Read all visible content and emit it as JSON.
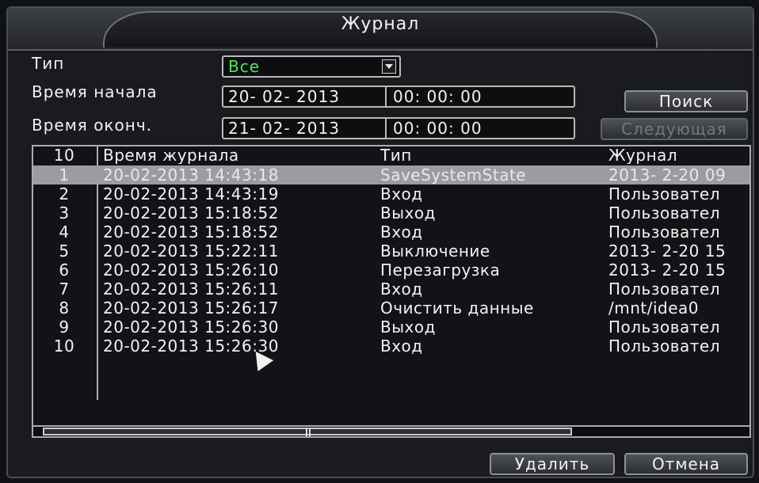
{
  "window": {
    "title": "Журнал"
  },
  "filters": {
    "type_label": "Тип",
    "type_value": "Все",
    "start_label": "Время начала",
    "start_date": "20- 02- 2013",
    "start_time": "00: 00: 00",
    "end_label": "Время оконч.",
    "end_date": "21- 02- 2013",
    "end_time": "00: 00: 00"
  },
  "buttons": {
    "search": "Поиск",
    "next": "Следующая",
    "delete": "Удалить",
    "cancel": "Отмена"
  },
  "table": {
    "headers": {
      "num": "10",
      "time": "Время журнала",
      "type": "Тип",
      "log": "Журнал"
    },
    "rows": [
      {
        "num": "1",
        "time": "20-02-2013 14:43:18",
        "type": "SaveSystemState",
        "log": "2013- 2-20 09",
        "selected": true
      },
      {
        "num": "2",
        "time": "20-02-2013 14:43:19",
        "type": "Вход",
        "log": "Пользовател"
      },
      {
        "num": "3",
        "time": "20-02-2013 15:18:52",
        "type": "Выход",
        "log": "Пользовател"
      },
      {
        "num": "4",
        "time": "20-02-2013 15:18:52",
        "type": "Вход",
        "log": "Пользовател"
      },
      {
        "num": "5",
        "time": "20-02-2013 15:22:11",
        "type": "Выключение",
        "log": "2013- 2-20 15"
      },
      {
        "num": "6",
        "time": "20-02-2013 15:26:10",
        "type": "Перезагрузка",
        "log": "2013- 2-20 15"
      },
      {
        "num": "7",
        "time": "20-02-2013 15:26:11",
        "type": "Вход",
        "log": "Пользовател"
      },
      {
        "num": "8",
        "time": "20-02-2013 15:26:17",
        "type": "Очистить данные",
        "log": "/mnt/idea0"
      },
      {
        "num": "9",
        "time": "20-02-2013 15:26:30",
        "type": "Выход",
        "log": "Пользовател"
      },
      {
        "num": "10",
        "time": "20-02-2013 15:26:30",
        "type": "Вход",
        "log": "Пользовател"
      }
    ]
  }
}
